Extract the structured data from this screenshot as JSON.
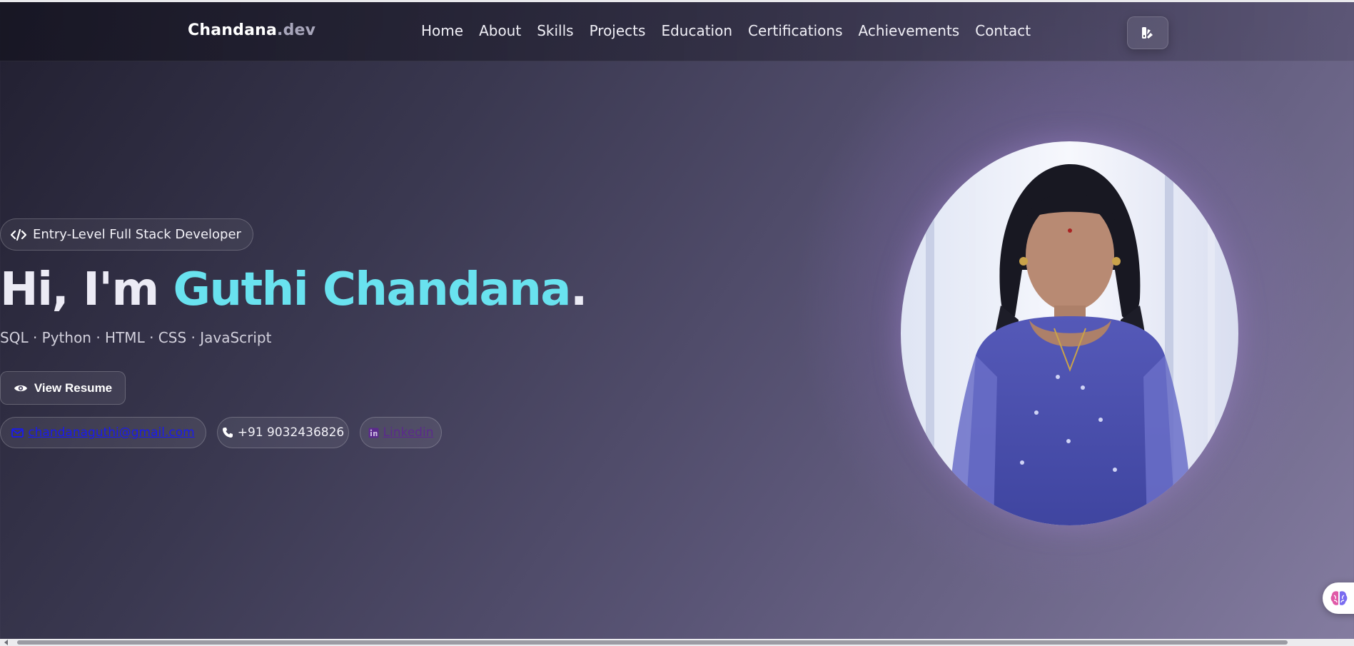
{
  "navbar": {
    "brand_main": "Chandana",
    "brand_suffix": ".dev",
    "links": [
      "Home",
      "About",
      "Skills",
      "Projects",
      "Education",
      "Certifications",
      "Achievements",
      "Contact"
    ],
    "theme_toggle_icon": "palette-icon"
  },
  "hero": {
    "badge_icon": "code-icon",
    "badge_text": "Entry-Level Full Stack Developer",
    "greeting": "Hi, I'm ",
    "name": "Guthi Chandana",
    "name_suffix": ".",
    "skills": "SQL · Python · HTML · CSS · JavaScript",
    "resume_button": "View Resume",
    "resume_icon": "eye-icon",
    "email": "chandanaguthi@gmail.com",
    "email_icon": "envelope-icon",
    "phone": "+91 9032436826",
    "phone_icon": "phone-icon",
    "linkedin": "Linkedin",
    "linkedin_icon": "linkedin-icon"
  },
  "floating_button_icon": "brain-icon",
  "colors": {
    "accent_name": "#69e2ef",
    "email_link": "#1a1aee",
    "linkedin_link": "#5b2a8c"
  }
}
